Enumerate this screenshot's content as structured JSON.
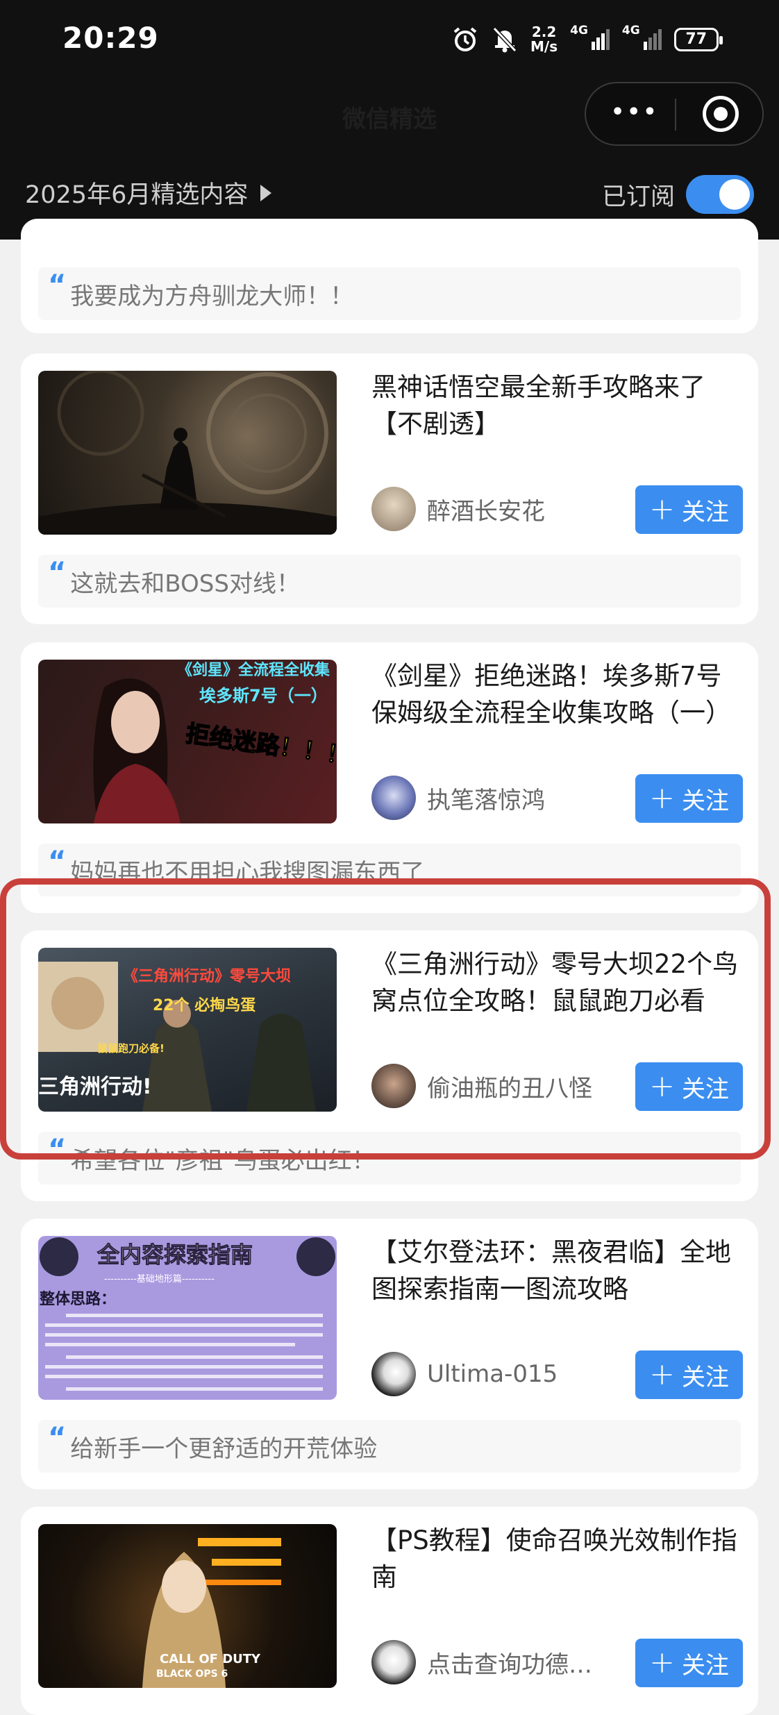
{
  "status_bar": {
    "time": "20:29",
    "speed_value": "2.2",
    "speed_unit": "M/s",
    "net1": "4G",
    "net2": "4G",
    "battery": "77"
  },
  "header": {
    "faint_title": "微信精选",
    "month_label": "2025年6月精选内容",
    "subscribed_label": "已订阅"
  },
  "follow_label": "关注",
  "partial_card": {
    "quote": "我要成为方舟驯龙大师！！"
  },
  "cards": [
    {
      "title": "黑神话悟空最全新手攻略来了【不剧透】",
      "author": "醉酒长安花",
      "quote": "这就去和BOSS对线！"
    },
    {
      "title": "《剑星》拒绝迷路！埃多斯7号保姆级全流程全收集攻略（一）",
      "author": "执笔落惊鸿",
      "quote": "妈妈再也不用担心我搜图漏东西了",
      "thumb_text": {
        "t1": "《剑星》全流程全收集",
        "t2": "埃多斯7号（一）",
        "t3": "拒绝迷路！！！"
      }
    },
    {
      "title": "《三角洲行动》零号大坝22个鸟窝点位全攻略！鼠鼠跑刀必看",
      "author": "偷油瓶的丑八怪",
      "quote": "希望各位\"彦祖\"鸟蛋必出红！",
      "thumb_text": {
        "t1": "《三角洲行动》零号大坝",
        "t2": "22个 必掏鸟蛋",
        "t3": "鼠鼠跑刀必备!",
        "t4": "三角洲行动!"
      }
    },
    {
      "title": "【艾尔登法环：黑夜君临】全地图探索指南一图流攻略",
      "author": "Ultima-015",
      "quote": "给新手一个更舒适的开荒体验",
      "thumb_text": {
        "t1": "全内容探索指南",
        "t2": "----------基础地形篇----------",
        "t3": "整体思路："
      }
    },
    {
      "title": "【PS教程】使命召唤光效制作指南",
      "author": "点击查询功德…",
      "thumb_text": {
        "t1": "CALL OF DUTY",
        "t2": "BLACK OPS 6"
      }
    }
  ]
}
